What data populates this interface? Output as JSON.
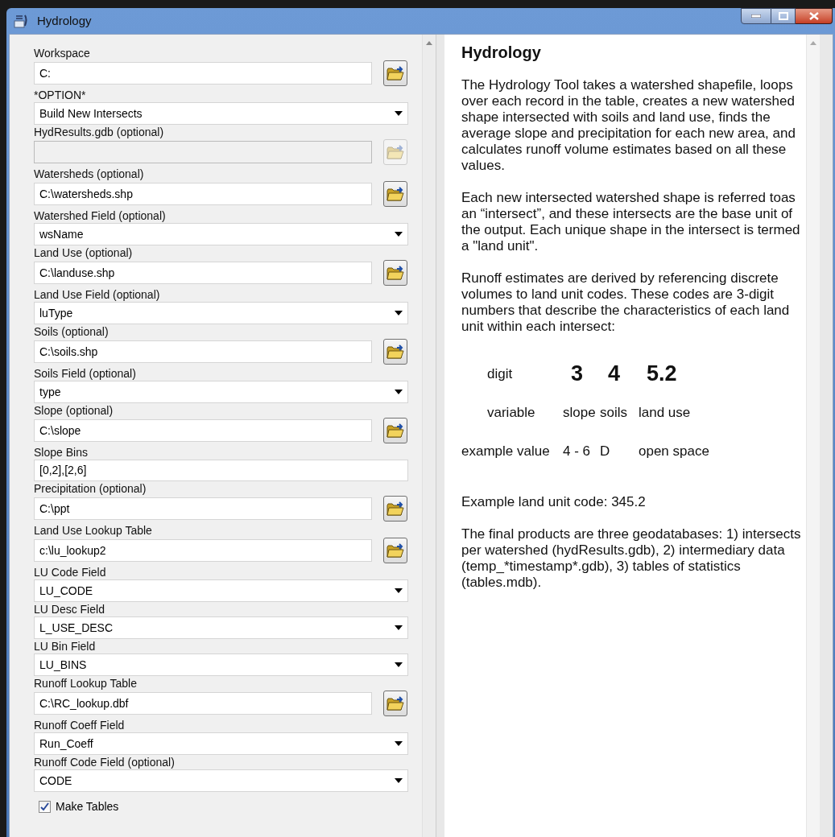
{
  "window": {
    "title": "Hydrology"
  },
  "parameters": [
    {
      "kind": "file",
      "label": "Workspace",
      "value": "C:",
      "disabled": false
    },
    {
      "kind": "dropdown",
      "label": "*OPTION*",
      "value": "Build New Intersects"
    },
    {
      "kind": "file",
      "label": "HydResults.gdb (optional)",
      "disabled": true
    },
    {
      "kind": "file",
      "label": "Watersheds (optional)",
      "value": "C:\\watersheds.shp",
      "disabled": false
    },
    {
      "kind": "dropdown",
      "label": "Watershed Field (optional)",
      "value": "wsName"
    },
    {
      "kind": "file",
      "label": "Land Use (optional)",
      "value": "C:\\landuse.shp",
      "disabled": false
    },
    {
      "kind": "dropdown",
      "label": "Land Use Field (optional)",
      "value": "luType"
    },
    {
      "kind": "file",
      "label": "Soils (optional)",
      "value": "C:\\soils.shp",
      "disabled": false
    },
    {
      "kind": "dropdown",
      "label": "Soils Field (optional)",
      "value": "type"
    },
    {
      "kind": "file",
      "label": "Slope (optional)",
      "value": "C:\\slope",
      "disabled": false
    },
    {
      "kind": "text",
      "label": "Slope Bins",
      "value": "[0,2],[2,6]"
    },
    {
      "kind": "file",
      "label": "Precipitation (optional)",
      "value": "C:\\ppt",
      "disabled": false
    },
    {
      "kind": "file",
      "label": "Land Use Lookup Table",
      "value": "c:\\lu_lookup2",
      "disabled": false
    },
    {
      "kind": "dropdown",
      "label": "LU Code Field",
      "value": "LU_CODE"
    },
    {
      "kind": "dropdown",
      "label": "LU Desc Field",
      "value": "L_USE_DESC"
    },
    {
      "kind": "dropdown",
      "label": "LU Bin Field",
      "value": "LU_BINS"
    },
    {
      "kind": "file",
      "label": "Runoff Lookup Table",
      "value": "C:\\RC_lookup.dbf",
      "disabled": false
    },
    {
      "kind": "dropdown",
      "label": "Runoff Coeff Field",
      "value": "Run_Coeff"
    },
    {
      "kind": "dropdown",
      "label": "Runoff Code Field (optional)",
      "value": "CODE"
    },
    {
      "kind": "checkbox",
      "label": "Make Tables",
      "checked": true
    }
  ],
  "help": {
    "title": "Hydrology",
    "paragraphs_top": [
      "The Hydrology Tool takes a watershed shapefile, loops over each record in the table, creates a new watershed shape intersected with soils and land use, finds the average slope and precipitation for each new area, and calculates runoff volume estimates based on all these values.",
      "Each new intersected watershed shape is referred toas an “intersect”, and these intersects are the base unit of the output. Each unique shape in the intersect is termed a \"land unit\".",
      "Runoff estimates are derived by referencing discrete volumes to land unit codes. These codes are 3-digit numbers that describe the characteristics of each land unit within each intersect:"
    ],
    "code_table": [
      {
        "kind": "digits",
        "header": "digit",
        "cells": [
          "3",
          "4",
          "5.2"
        ]
      },
      {
        "kind": "plain",
        "header": "variable",
        "cells": [
          "slope",
          "soils",
          "land use"
        ]
      },
      {
        "kind": "plain",
        "header": "example value",
        "cells": [
          "4 - 6",
          "D",
          "open space"
        ]
      }
    ],
    "paragraphs_bottom": [
      "Example land unit code: 345.2",
      "The final products are three geodatabases: 1) intersects per watershed (hydResults.gdb), 2) intermediary data (temp_*timestamp*.gdb), 3) tables of statistics (tables.mdb)."
    ]
  }
}
